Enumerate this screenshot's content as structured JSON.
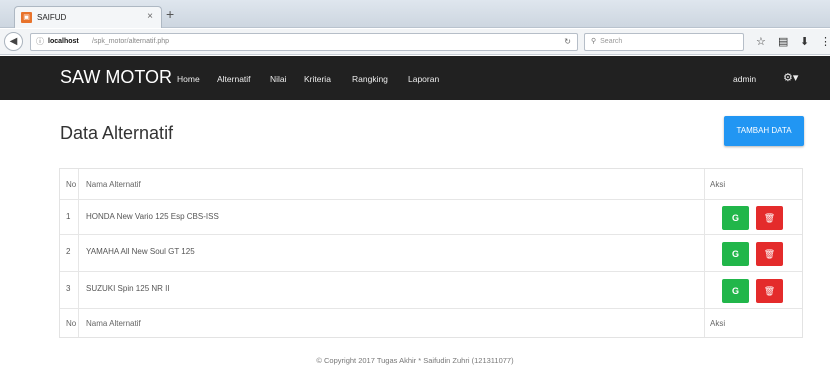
{
  "browser": {
    "tab_title": "SAIFUD",
    "tab_close": "×",
    "new_tab": "+",
    "url_host": "localhost",
    "url_path": "/spk_motor/alternatif.php",
    "search_placeholder": "Search"
  },
  "nav": {
    "brand": "SAW MOTOR",
    "items": [
      "Home",
      "Alternatif",
      "Nilai",
      "Kriteria",
      "Rangking",
      "Laporan"
    ],
    "user": "admin"
  },
  "page": {
    "title": "Data Alternatif",
    "add_button": "TAMBAH DATA"
  },
  "table": {
    "headers": {
      "no": "No",
      "name": "Nama Alternatif",
      "aksi": "Aksi"
    },
    "rows": [
      {
        "no": "1",
        "name": "HONDA New Vario 125 Esp CBS-ISS"
      },
      {
        "no": "2",
        "name": "YAMAHA All New Soul GT 125"
      },
      {
        "no": "3",
        "name": "SUZUKI Spin 125 NR II"
      }
    ]
  },
  "footer": "© Copyright 2017 Tugas Akhir * Saifudin Zuhri (121311077)",
  "colors": {
    "navbar": "#212121",
    "primary": "#2196f3",
    "edit": "#21b64a",
    "delete": "#e42b2b"
  }
}
